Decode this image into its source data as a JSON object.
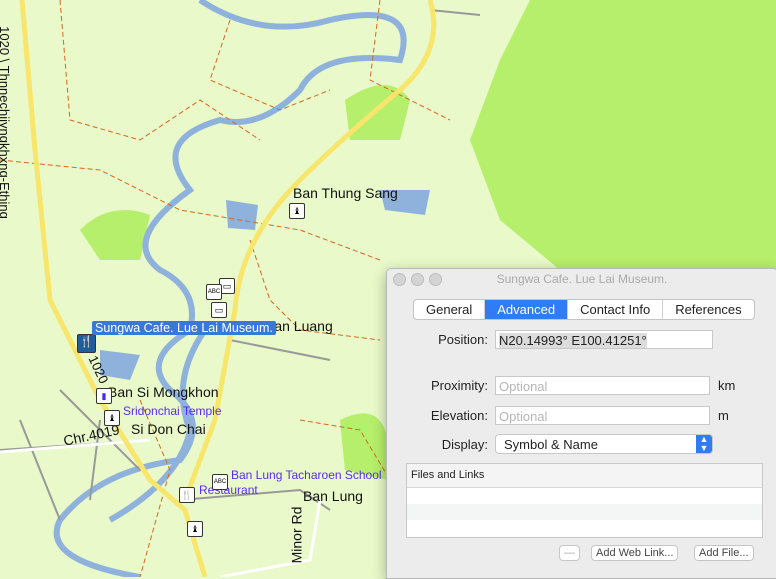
{
  "map": {
    "road_label_1020_long": "1020 \\ Thnnechiiyngkhxng-Ething",
    "road_label_1020": "1020",
    "road_label_chr4019": "Chr.4019",
    "road_label_minor": "Minor Rd",
    "places": [
      "Ban Thung Sang",
      "Ban Luang",
      "Ban Si Mongkhon",
      "Si Don Chai",
      "Ban Lung"
    ],
    "pois": [
      "Sridonchai Temple",
      "Ban Lung Tacharoen School",
      "Restaurant"
    ],
    "selected_waypoint": "Sungwa Cafe. Lue Lai Museum.",
    "colors": {
      "land": "#e9f9c9",
      "forest": "#b6ef6b",
      "water": "#8fb2dc",
      "highway": "#f7e56c",
      "boundary": "#d2691e"
    }
  },
  "dialog": {
    "title": "Sungwa Cafe. Lue Lai Museum.",
    "tabs": [
      "General",
      "Advanced",
      "Contact Info",
      "References"
    ],
    "active_tab": "Advanced",
    "position_label": "Position:",
    "position_value": "N20.14993° E100.41251°",
    "proximity_label": "Proximity:",
    "proximity_placeholder": "Optional",
    "proximity_unit": "km",
    "elevation_label": "Elevation:",
    "elevation_placeholder": "Optional",
    "elevation_unit": "m",
    "display_label": "Display:",
    "display_value": "Symbol & Name",
    "files_header": "Files and Links",
    "remove_button": "—",
    "add_web_link_button": "Add Web Link...",
    "add_file_button": "Add File..."
  }
}
